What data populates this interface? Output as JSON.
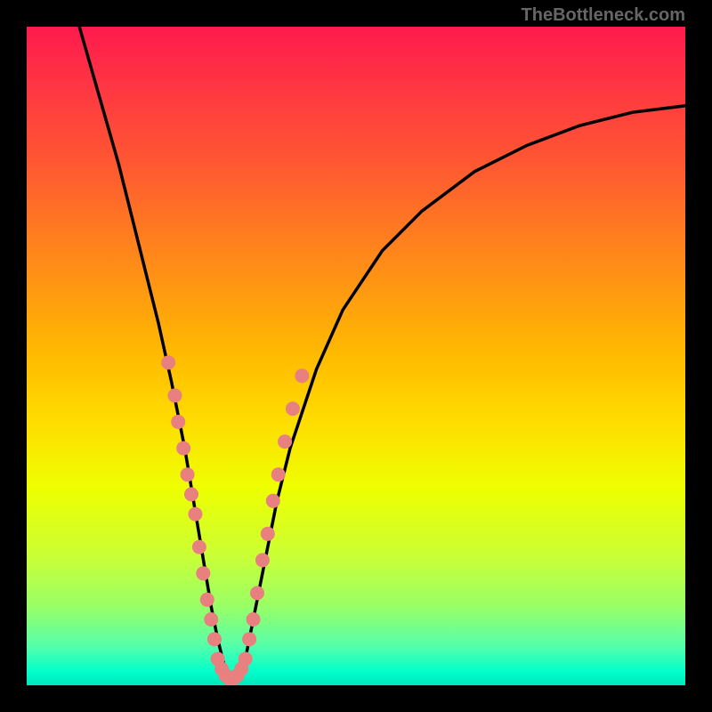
{
  "attribution": "TheBottleneck.com",
  "chart_data": {
    "type": "line",
    "title": "",
    "xlabel": "",
    "ylabel": "",
    "xlim": [
      0,
      100
    ],
    "ylim": [
      0,
      100
    ],
    "curve": {
      "name": "bottleneck-curve",
      "x": [
        8,
        10,
        12,
        14,
        16,
        18,
        20,
        22,
        24,
        25,
        26,
        27,
        28,
        29,
        30,
        31,
        32,
        33,
        34,
        36,
        38,
        40,
        44,
        48,
        54,
        60,
        68,
        76,
        84,
        92,
        100
      ],
      "y": [
        100,
        93,
        86,
        79,
        71,
        63,
        55,
        46,
        36,
        30,
        24,
        18,
        12,
        7,
        3,
        1,
        1,
        3,
        8,
        18,
        28,
        36,
        48,
        57,
        66,
        72,
        78,
        82,
        85,
        87,
        88
      ]
    },
    "markers": {
      "name": "data-points",
      "color": "#e88080",
      "radius": 8,
      "points": [
        {
          "x": 21.5,
          "y": 49
        },
        {
          "x": 22.5,
          "y": 44
        },
        {
          "x": 23.0,
          "y": 40
        },
        {
          "x": 23.8,
          "y": 36
        },
        {
          "x": 24.4,
          "y": 32
        },
        {
          "x": 25.0,
          "y": 29
        },
        {
          "x": 25.6,
          "y": 26
        },
        {
          "x": 26.2,
          "y": 21
        },
        {
          "x": 26.8,
          "y": 17
        },
        {
          "x": 27.4,
          "y": 13
        },
        {
          "x": 28.0,
          "y": 10
        },
        {
          "x": 28.5,
          "y": 7
        },
        {
          "x": 29.0,
          "y": 4
        },
        {
          "x": 29.6,
          "y": 2.5
        },
        {
          "x": 30.2,
          "y": 1.5
        },
        {
          "x": 30.8,
          "y": 1
        },
        {
          "x": 31.4,
          "y": 1
        },
        {
          "x": 32.0,
          "y": 1.5
        },
        {
          "x": 32.6,
          "y": 2.5
        },
        {
          "x": 33.2,
          "y": 4
        },
        {
          "x": 33.8,
          "y": 7
        },
        {
          "x": 34.4,
          "y": 10
        },
        {
          "x": 35.0,
          "y": 14
        },
        {
          "x": 35.8,
          "y": 19
        },
        {
          "x": 36.6,
          "y": 23
        },
        {
          "x": 37.4,
          "y": 28
        },
        {
          "x": 38.2,
          "y": 32
        },
        {
          "x": 39.2,
          "y": 37
        },
        {
          "x": 40.4,
          "y": 42
        },
        {
          "x": 41.8,
          "y": 47
        }
      ]
    }
  }
}
